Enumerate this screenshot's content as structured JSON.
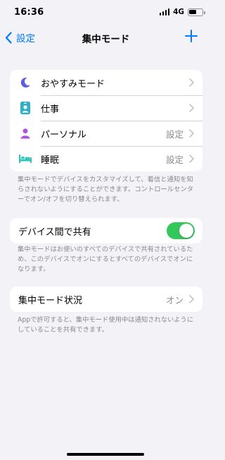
{
  "status_bar": {
    "time": "16:36",
    "network": "4G",
    "battery_level": 0.55
  },
  "navbar": {
    "back_label": "設定",
    "title": "集中モード"
  },
  "focus_modes": [
    {
      "label": "おやすみモード",
      "value": "",
      "icon": "moon-icon",
      "color": "#5e5ce6"
    },
    {
      "label": "仕事",
      "value": "",
      "icon": "id-badge-icon",
      "color": "#30b0c7"
    },
    {
      "label": "パーソナル",
      "value": "設定",
      "icon": "person-icon",
      "color": "#af52de"
    },
    {
      "label": "睡眠",
      "value": "設定",
      "icon": "bed-icon",
      "color": "#30c5b5"
    }
  ],
  "focus_note": "集中モードでデバイスをカスタマイズして、着信と通知を知らされないようにすることができます。コントロールセンターでオン/オフを切り替えられます。",
  "share_across_devices": {
    "label": "デバイス間で共有",
    "enabled": true
  },
  "share_note": "集中モードはお使いのすべてのデバイスで共有されているため、このデバイスでオンにするとすべてのデバイスでオンになります。",
  "focus_status": {
    "label": "集中モード状況",
    "value": "オン"
  },
  "status_note": "Appで許可すると、集中モード使用中は通知されないようにしていることを共有できます。",
  "colors": {
    "accent": "#007aff",
    "toggle_on": "#34c759",
    "background": "#f2f2f7"
  }
}
